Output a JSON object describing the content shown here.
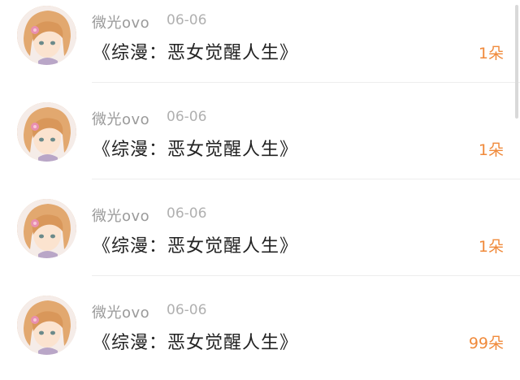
{
  "items": [
    {
      "username": "微光ovo",
      "date": "06-06",
      "title": "《综漫：恶女觉醒人生》",
      "count": "1朵"
    },
    {
      "username": "微光ovo",
      "date": "06-06",
      "title": "《综漫：恶女觉醒人生》",
      "count": "1朵"
    },
    {
      "username": "微光ovo",
      "date": "06-06",
      "title": "《综漫：恶女觉醒人生》",
      "count": "1朵"
    },
    {
      "username": "微光ovo",
      "date": "06-06",
      "title": "《综漫：恶女觉醒人生》",
      "count": "99朵"
    }
  ],
  "colors": {
    "accent": "#f08a3b",
    "username": "#9a9a9a",
    "title": "#222222"
  },
  "icons": {
    "avatar": "anime-avatar-icon"
  }
}
